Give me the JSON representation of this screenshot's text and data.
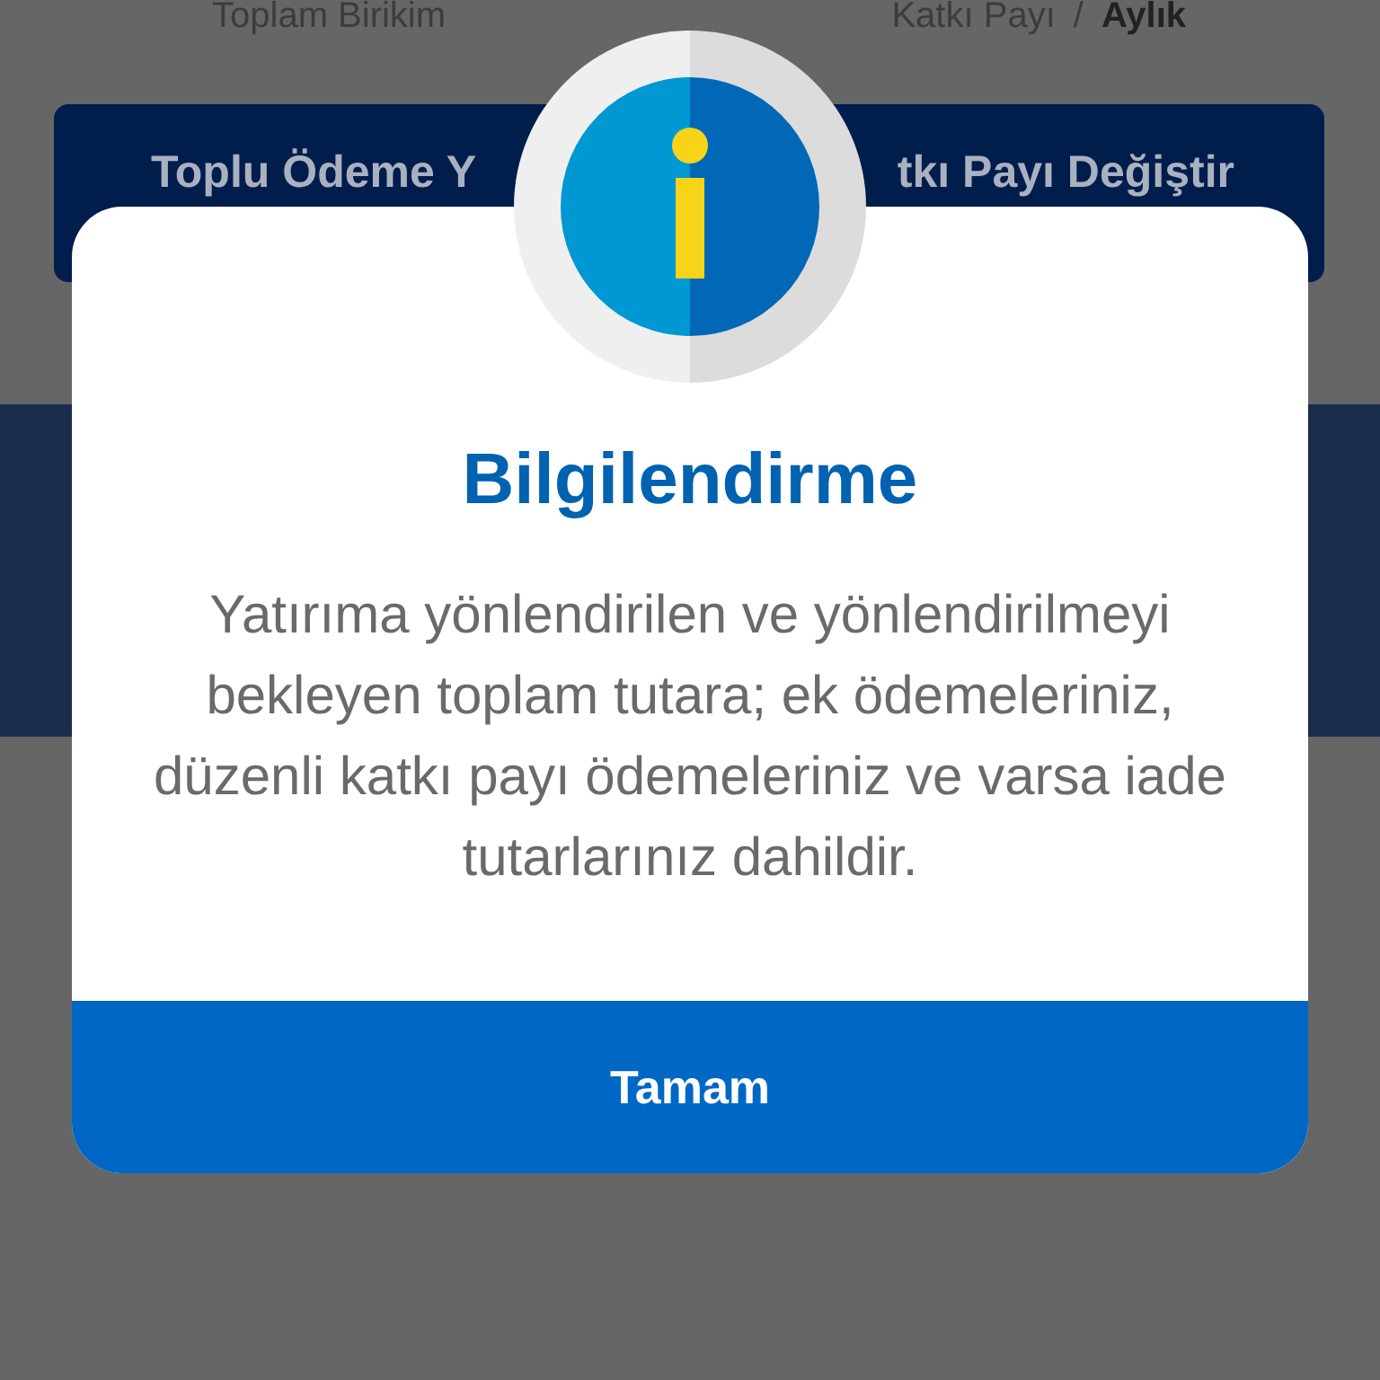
{
  "background": {
    "summary_labels": [
      "Toplam Birikim"
    ],
    "period": {
      "label": "Katkı Payı",
      "separator": "/",
      "value": "Aylık"
    },
    "buttons": [
      "Toplu Ödeme Y",
      "tkı Payı Değiştir"
    ]
  },
  "dialog": {
    "title": "Bilgilendirme",
    "message": "Yatırıma yönlendirilen ve yönlendirilmeyi bekleyen toplam tutara; ek ödemeleriniz, düzenli katkı payı ödemeleriniz ve varsa iade tutarlarınız dahildir.",
    "button": "Tamam"
  }
}
